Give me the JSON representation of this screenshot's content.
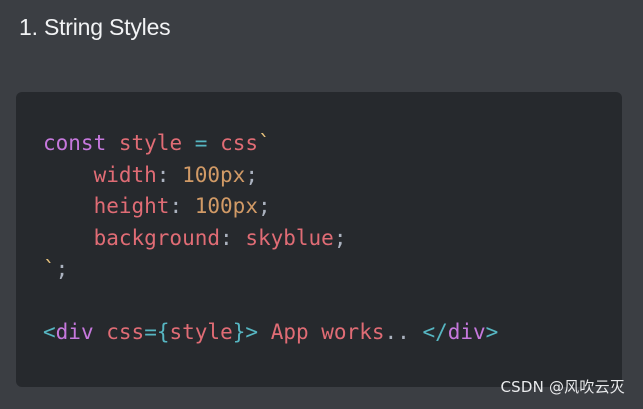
{
  "heading": "1. String Styles",
  "code": {
    "line1": {
      "keyword": "const",
      "variable": "style",
      "operator": "=",
      "function": "css",
      "backtick": "`"
    },
    "line2": {
      "property": "width",
      "colon": ":",
      "value": "100px",
      "semicolon": ";"
    },
    "line3": {
      "property": "height",
      "colon": ":",
      "value": "100px",
      "semicolon": ";"
    },
    "line4": {
      "property": "background",
      "colon": ":",
      "value": "skyblue",
      "semicolon": ";"
    },
    "line5": {
      "backtick": "`",
      "semicolon": ";"
    },
    "line7": {
      "open_angle": "<",
      "tag": "div",
      "attr": "css",
      "equals": "=",
      "open_brace": "{",
      "ident": "style",
      "close_brace": "}",
      "close_angle": ">",
      "text": "App works",
      "ellipsis": "..",
      "close_open_angle": "</",
      "close_tag": "div",
      "close_end_angle": ">"
    }
  },
  "watermark": "CSDN @风吹云灭"
}
